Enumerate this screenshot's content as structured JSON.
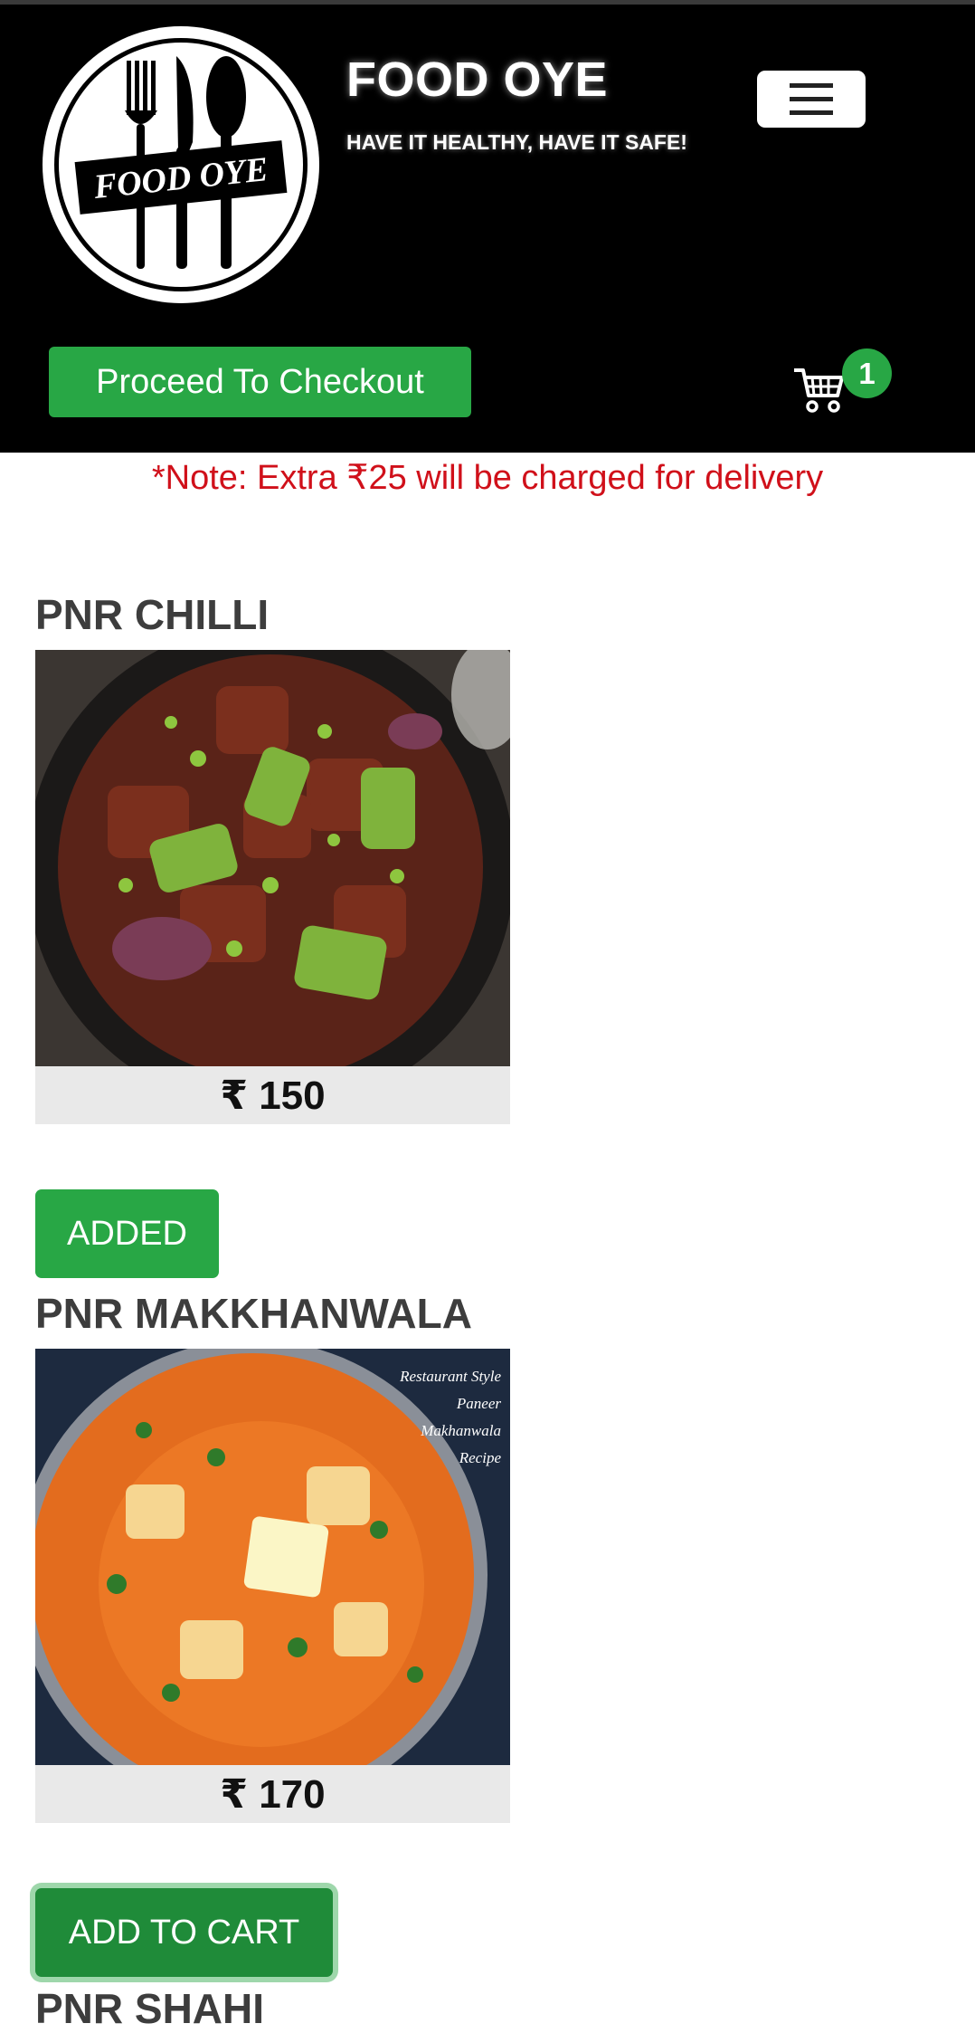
{
  "header": {
    "logo_text": "FOOD OYE",
    "title": "FOOD OYE",
    "tagline": "HAVE IT HEALTHY, HAVE IT SAFE!",
    "checkout_label": "Proceed To Checkout",
    "cart_count": "1"
  },
  "note": "*Note: Extra ₹25 will be charged for delivery",
  "items": [
    {
      "name": "PNR CHILLI",
      "price": "₹ 150",
      "button_label": "ADDED"
    },
    {
      "name": "PNR MAKKHANWALA",
      "price": "₹ 170",
      "button_label": "ADD TO CART",
      "image_caption": [
        "Restaurant Style",
        "Paneer",
        "Makhanwala",
        "Recipe"
      ]
    },
    {
      "name": "PNR SHAHI"
    }
  ],
  "icons": {
    "menu": "hamburger-menu-icon",
    "cart": "shopping-cart-icon"
  },
  "colors": {
    "accent": "#28a745",
    "note": "#d0101a",
    "header_bg": "#000000"
  }
}
